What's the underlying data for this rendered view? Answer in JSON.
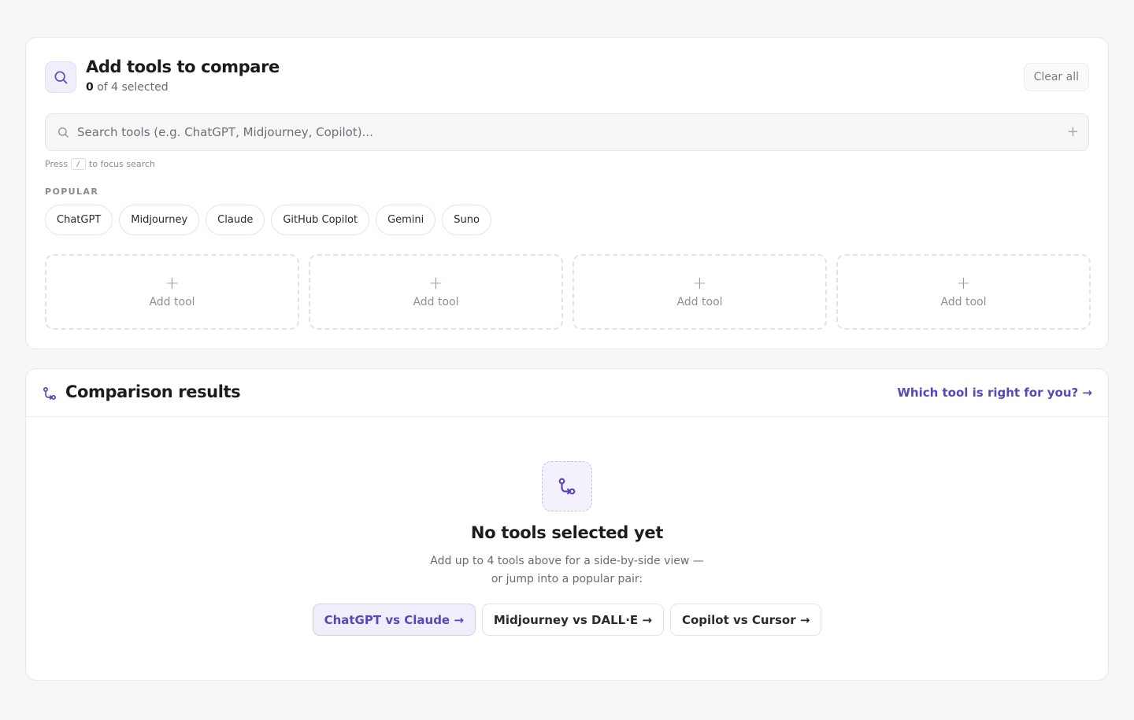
{
  "colors": {
    "accent": "#5b45b8",
    "accent_soft": "#f1eefb",
    "background": "#f7f7f7",
    "card": "#ffffff",
    "muted_text": "#6b6b73"
  },
  "add_panel": {
    "icon": "search-icon",
    "title": "Add tools to compare",
    "selected_count": "0",
    "selected_suffix": "of 4 selected",
    "clear_all_label": "Clear all",
    "search": {
      "placeholder": "Search tools (e.g. ChatGPT, Midjourney, Copilot)...",
      "value": "",
      "add_icon": "plus-icon"
    },
    "hint": {
      "before": "Press",
      "key": "/",
      "after": "to focus search"
    },
    "popular_label": "POPULAR",
    "popular": [
      "ChatGPT",
      "Midjourney",
      "Claude",
      "GitHub Copilot",
      "Gemini",
      "Suno"
    ],
    "slots": [
      {
        "label": "Add tool",
        "icon": "plus-icon"
      },
      {
        "label": "Add tool",
        "icon": "plus-icon"
      },
      {
        "label": "Add tool",
        "icon": "plus-icon"
      },
      {
        "label": "Add tool",
        "icon": "plus-icon"
      }
    ]
  },
  "results_panel": {
    "icon": "git-compare-icon",
    "title": "Comparison results",
    "guide_link": "Which tool is right for you? →",
    "empty": {
      "icon": "git-compare-icon",
      "title": "No tools selected yet",
      "desc_line1": "Add up to 4 tools above for a side-by-side view —",
      "desc_line2": "or jump into a popular pair:"
    },
    "pairs": [
      "ChatGPT vs Claude →",
      "Midjourney vs DALL·E →",
      "Copilot vs Cursor →"
    ]
  }
}
